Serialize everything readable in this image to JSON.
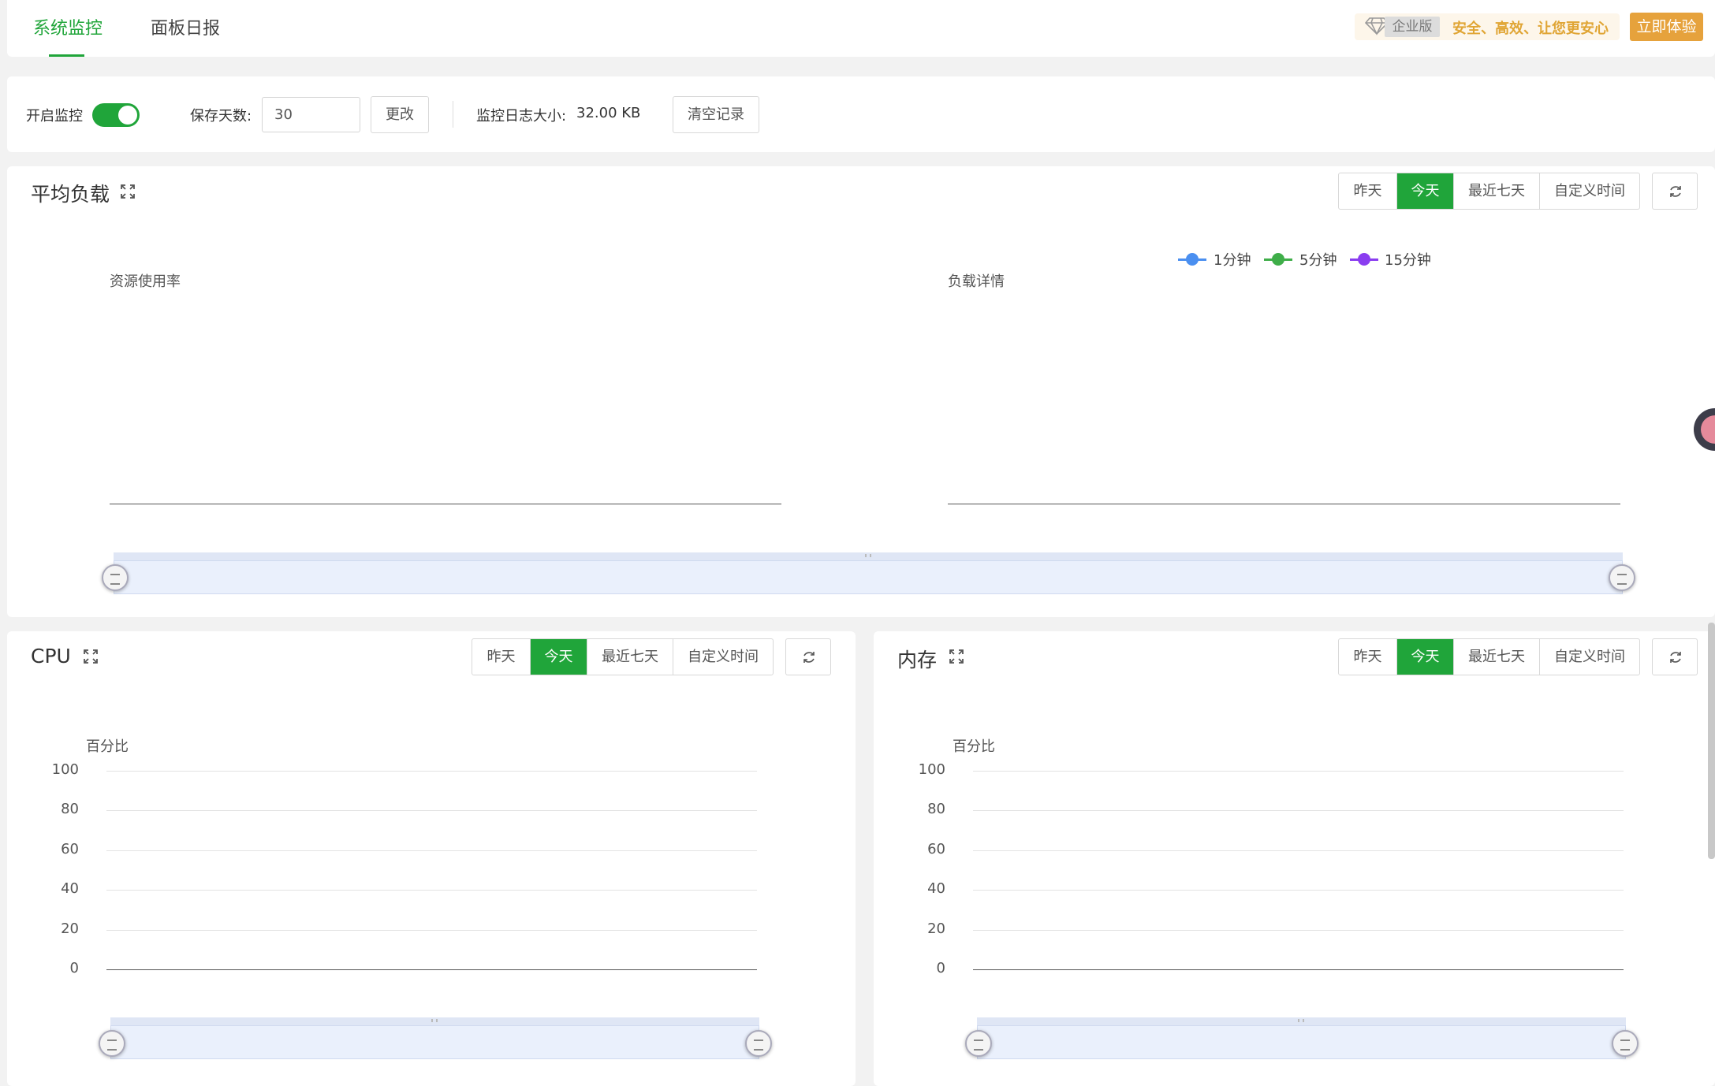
{
  "tabs": [
    {
      "label": "系统监控",
      "active": true
    },
    {
      "label": "面板日报",
      "active": false
    }
  ],
  "enterprise": {
    "badge": "企业版",
    "slogan": "安全、高效、让您更安心",
    "try_button": "立即体验"
  },
  "settings": {
    "monitor_label": "开启监控",
    "monitor_enabled": true,
    "retention_label": "保存天数:",
    "retention_value": "30",
    "change_button": "更改",
    "log_size_label": "监控日志大小:",
    "log_size_value": "32.00 KB",
    "clear_button": "清空记录"
  },
  "range_options": [
    "昨天",
    "今天",
    "最近七天",
    "自定义时间"
  ],
  "active_range": "今天",
  "load_panel": {
    "title": "平均负载",
    "left_chart_title": "资源使用率",
    "right_chart_title": "负载详情",
    "legend": [
      "1分钟",
      "5分钟",
      "15分钟"
    ]
  },
  "cpu_panel": {
    "title": "CPU",
    "axis_title": "百分比"
  },
  "memory_panel": {
    "title": "内存",
    "axis_title": "百分比"
  },
  "colors": {
    "accent": "#20a53a",
    "series_1min": "#4a8ff0",
    "series_5min": "#3fae49",
    "series_15min": "#8a3df0",
    "enterprise": "#e6a23c"
  },
  "chart_data": [
    {
      "type": "line",
      "title": "资源使用率",
      "series": [],
      "x": []
    },
    {
      "type": "line",
      "title": "负载详情",
      "series": [
        {
          "name": "1分钟",
          "values": []
        },
        {
          "name": "5分钟",
          "values": []
        },
        {
          "name": "15分钟",
          "values": []
        }
      ],
      "x": []
    },
    {
      "type": "line",
      "title": "CPU",
      "ylabel": "百分比",
      "ylim": [
        0,
        100
      ],
      "yticks": [
        "100",
        "80",
        "60",
        "40",
        "20",
        "0"
      ],
      "series": [],
      "x": []
    },
    {
      "type": "line",
      "title": "内存",
      "ylabel": "百分比",
      "ylim": [
        0,
        100
      ],
      "yticks": [
        "100",
        "80",
        "60",
        "40",
        "20",
        "0"
      ],
      "series": [],
      "x": []
    }
  ]
}
